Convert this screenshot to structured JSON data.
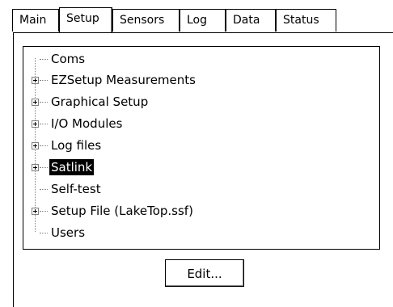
{
  "tabs": [
    {
      "label": "Main"
    },
    {
      "label": "Setup"
    },
    {
      "label": "Sensors"
    },
    {
      "label": "Log"
    },
    {
      "label": "Data"
    },
    {
      "label": "Status"
    }
  ],
  "active_tab": "Setup",
  "tree": {
    "items": [
      {
        "label": "Coms",
        "expandable": false
      },
      {
        "label": "EZSetup Measurements",
        "expandable": true
      },
      {
        "label": "Graphical Setup",
        "expandable": true
      },
      {
        "label": "I/O Modules",
        "expandable": true
      },
      {
        "label": "Log files",
        "expandable": true
      },
      {
        "label": "Satlink",
        "expandable": true,
        "selected": true
      },
      {
        "label": "Self-test",
        "expandable": false
      },
      {
        "label": "Setup File (LakeTop.ssf)",
        "expandable": true
      },
      {
        "label": "Users",
        "expandable": false
      }
    ]
  },
  "edit_button": {
    "label": "Edit..."
  }
}
